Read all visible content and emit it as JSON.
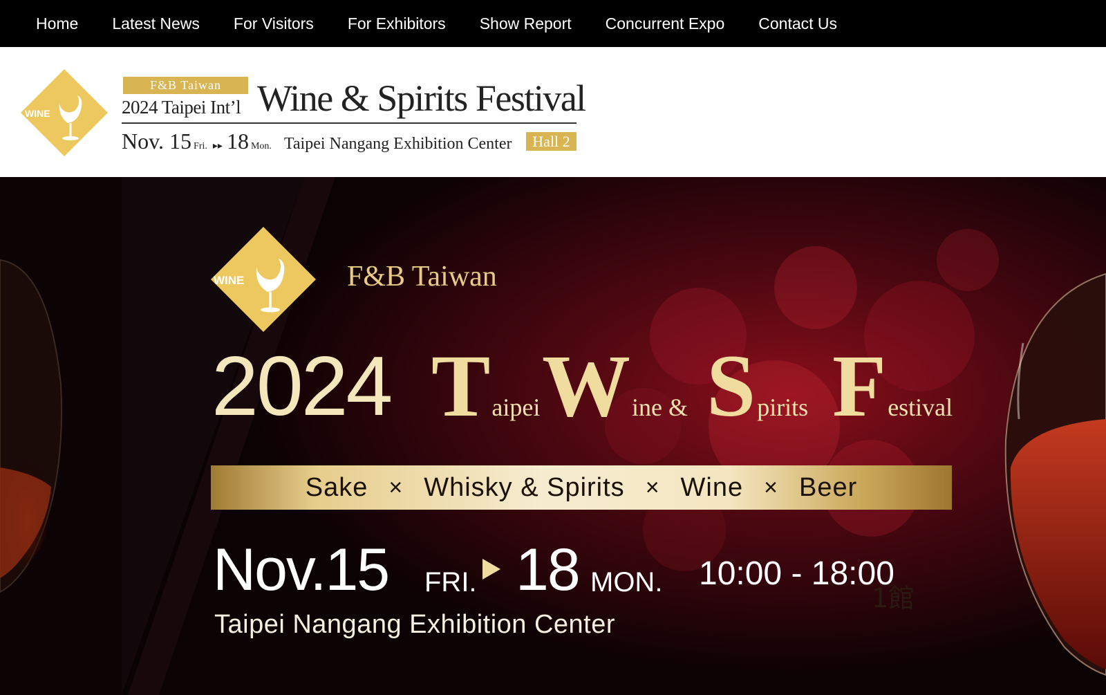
{
  "nav": {
    "items": [
      "Home",
      "Latest News",
      "For Visitors",
      "For Exhibitors",
      "Show Report",
      "Concurrent Expo",
      "Contact Us"
    ]
  },
  "header": {
    "logo_text": "WINE",
    "tag": "F&B Taiwan",
    "subtitle": "2024 Taipei Int’l",
    "title": "Wine & Spirits Festival",
    "date_start": "Nov. 15",
    "day_start": "Fri.",
    "date_end": "18",
    "day_end": "Mon.",
    "venue": "Taipei Nangang Exhibition Center",
    "hall": "Hall 2"
  },
  "hero": {
    "logo_text": "WINE",
    "tag": "F&B Taiwan",
    "year": "2024",
    "title_words": [
      {
        "cap": "T",
        "rest": "aipei"
      },
      {
        "cap": "W",
        "rest": "ine &"
      },
      {
        "cap": "S",
        "rest": "pirits"
      },
      {
        "cap": "F",
        "rest": "estival"
      }
    ],
    "categories": [
      "Sake",
      "Whisky & Spirits",
      "Wine",
      "Beer"
    ],
    "separator": "×",
    "date_start": "Nov.15",
    "day_start": "FRI.",
    "date_end": "18",
    "day_end": "MON.",
    "time": "10:00 - 18:00",
    "venue": "Taipei Nangang Exhibition Center",
    "hall_zh": "1館"
  },
  "colors": {
    "gold": "#d9b452",
    "nav_bg": "#000000",
    "hero_bg": "#0a0203"
  }
}
